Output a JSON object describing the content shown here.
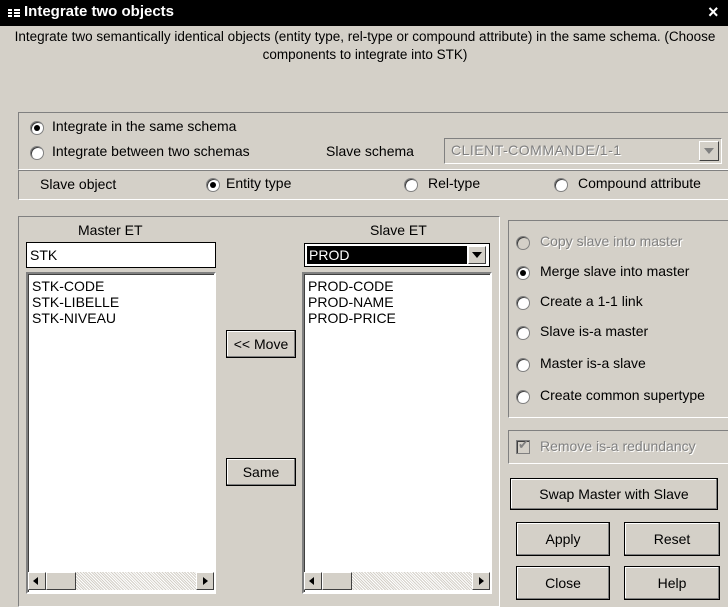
{
  "window": {
    "title": "Integrate two objects",
    "close_glyph": "×"
  },
  "description": "Integrate two semantically identical objects (entity type, rel-type or compound attribute) in the same schema. (Choose components to integrate into STK)",
  "scope": {
    "same_schema_label": "Integrate in the same schema",
    "two_schemas_label": "Integrate between two schemas",
    "selected": "same_schema",
    "slave_schema_label": "Slave schema",
    "slave_schema_value": "CLIENT-COMMANDE/1-1"
  },
  "slave_object": {
    "label": "Slave object",
    "options": [
      "Entity type",
      "Rel-type",
      "Compound attribute"
    ],
    "selected": "Entity type"
  },
  "master": {
    "header": "Master ET",
    "name": "STK",
    "components": [
      "STK-CODE",
      "STK-LIBELLE",
      "STK-NIVEAU"
    ]
  },
  "slave": {
    "header": "Slave ET",
    "name": "PROD",
    "components": [
      "PROD-CODE",
      "PROD-NAME",
      "PROD-PRICE"
    ]
  },
  "middle_buttons": {
    "move": "<< Move",
    "same": "Same"
  },
  "actions": {
    "options": [
      {
        "label": "Copy slave into master",
        "enabled": false,
        "checked": false
      },
      {
        "label": "Merge slave into master",
        "enabled": true,
        "checked": true
      },
      {
        "label": "Create a 1-1 link",
        "enabled": true,
        "checked": false
      },
      {
        "label": "Slave is-a master",
        "enabled": true,
        "checked": false
      },
      {
        "label": "Master is-a slave",
        "enabled": true,
        "checked": false
      },
      {
        "label": "Create common supertype",
        "enabled": true,
        "checked": false
      }
    ],
    "remove_isa_label": "Remove is-a redundancy",
    "remove_isa_checked": true
  },
  "buttons": {
    "swap": "Swap Master with Slave",
    "apply": "Apply",
    "reset": "Reset",
    "close": "Close",
    "help": "Help"
  },
  "icons": {
    "title": "window-menu-icon",
    "close": "close-icon",
    "dropdown": "chevron-down-icon",
    "scroll_left": "arrow-left-icon",
    "scroll_right": "arrow-right-icon"
  }
}
